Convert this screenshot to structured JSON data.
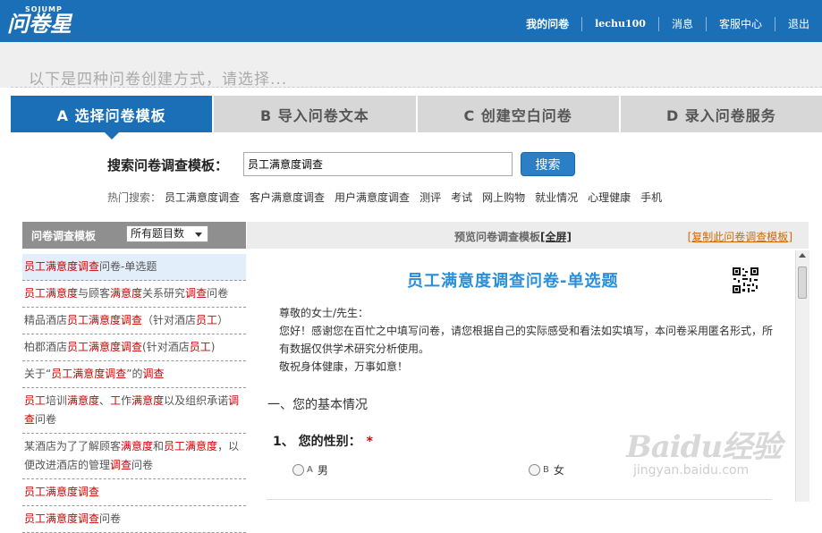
{
  "header": {
    "logo_small": "SOJUMP",
    "logo_main": "问卷星",
    "nav": [
      "我的问卷",
      "lechu100",
      "消息",
      "客服中心",
      "退出"
    ]
  },
  "intro": "以下是四种问卷创建方式，请选择...",
  "tabs": [
    {
      "label": "A 选择问卷模板",
      "active": true
    },
    {
      "label": "B 导入问卷文本",
      "active": false
    },
    {
      "label": "C 创建空白问卷",
      "active": false
    },
    {
      "label": "D 录入问卷服务",
      "active": false
    }
  ],
  "search": {
    "label": "搜索问卷调查模板：",
    "value": "员工满意度调查",
    "button": "搜索",
    "hot_label": "热门搜索：",
    "hot": [
      "员工满意度调查",
      "客户满意度调查",
      "用户满意度调查",
      "测评",
      "考试",
      "网上购物",
      "就业情况",
      "心理健康",
      "手机"
    ]
  },
  "left_panel": {
    "title": "问卷调查模板",
    "select_value": "所有题目数",
    "items": [
      "员工满意度调查问卷-单选题",
      "员工满意度与顾客满意度关系研究调查问卷",
      "精品酒店员工满意度调查（针对酒店员工）",
      "柏郡酒店员工满意度调查(针对酒店员工)",
      "关于“员工满意度调查”的调查",
      "员工培训满意度、工作满意度以及组织承诺调查问卷",
      "某酒店为了了解顾客满意度和员工满意度，以便改进酒店的管理调查问卷",
      "员工满意度调查",
      "员工满意度调查问卷"
    ]
  },
  "preview": {
    "title": "预览问卷调查模板",
    "full": "[全屏]",
    "copy_open": "[",
    "copy": "复制此问卷调查模板",
    "copy_close": "]",
    "survey_title": "员工满意度调查问卷-单选题",
    "greeting": "尊敬的女士/先生：",
    "body": "您好！感谢您在百忙之中填写问卷，请您根据自己的实际感受和看法如实填写，本问卷采用匿名形式，所有数据仅供学术研究分析使用。",
    "wish": "敬祝身体健康，万事如意！",
    "section": "一、您的基本情况",
    "question": "1、  您的性别：",
    "required_mark": "*",
    "options": [
      {
        "letter": "A",
        "text": "男"
      },
      {
        "letter": "B",
        "text": "女"
      }
    ]
  },
  "watermark": {
    "main": "Baidu经验",
    "sub": "jingyan.baidu.com"
  }
}
